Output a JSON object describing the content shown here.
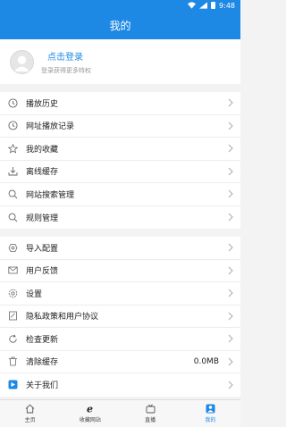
{
  "status": {
    "time": "9:48"
  },
  "header": {
    "title": "我的"
  },
  "profile": {
    "login_label": "点击登录",
    "subtitle": "登录获得更多特权"
  },
  "group1": [
    {
      "label": "播放历史",
      "icon": "clock-icon"
    },
    {
      "label": "网址播放记录",
      "icon": "clock-icon"
    },
    {
      "label": "我的收藏",
      "icon": "star-icon"
    },
    {
      "label": "离线缓存",
      "icon": "download-icon"
    },
    {
      "label": "网站搜索管理",
      "icon": "search-icon"
    },
    {
      "label": "规则管理",
      "icon": "search-icon"
    }
  ],
  "group2": [
    {
      "label": "导入配置",
      "icon": "import-icon"
    },
    {
      "label": "用户反馈",
      "icon": "mail-icon"
    },
    {
      "label": "设置",
      "icon": "gear-icon"
    },
    {
      "label": "隐私政策和用户协议",
      "icon": "document-icon"
    },
    {
      "label": "检查更新",
      "icon": "refresh-icon"
    },
    {
      "label": "清除缓存",
      "icon": "trash-icon",
      "value": "0.0MB"
    },
    {
      "label": "关于我们",
      "icon": "about-icon"
    }
  ],
  "tabs": [
    {
      "label": "主页",
      "icon": "home-icon"
    },
    {
      "label": "收藏网站",
      "icon": "browser-icon"
    },
    {
      "label": "直播",
      "icon": "tv-icon"
    },
    {
      "label": "我的",
      "icon": "user-icon"
    }
  ],
  "colors": {
    "accent": "#1e88e5"
  }
}
